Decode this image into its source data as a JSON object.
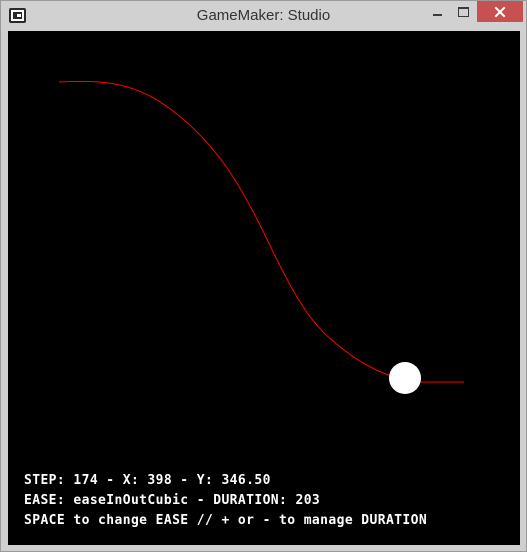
{
  "window": {
    "title": "GameMaker: Studio",
    "icons": {
      "app": "gamemaker-icon",
      "minimize": "minimize-icon",
      "maximize": "maximize-icon",
      "close": "close-icon"
    },
    "close_color": "#c75050"
  },
  "game": {
    "background": "#000000",
    "curve_color": "#ff0000",
    "ball_color": "#ffffff",
    "hud": {
      "line1": "STEP: 174 - X: 398 - Y: 346.50",
      "line2": "EASE: easeInOutCubic - DURATION: 203",
      "line3": "SPACE to change EASE // + or - to manage DURATION"
    }
  }
}
